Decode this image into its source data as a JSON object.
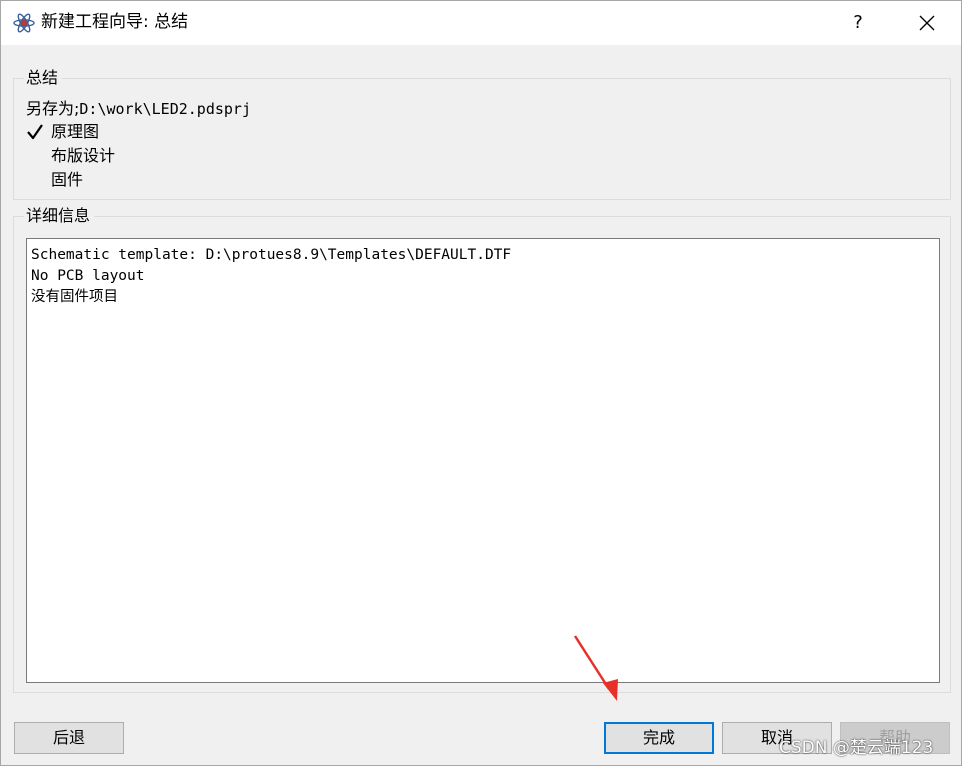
{
  "window": {
    "title": "新建工程向导: 总结",
    "help_label": "?",
    "icons": {
      "app": "proteus-app-icon",
      "close": "close-icon",
      "check": "checkmark-icon"
    }
  },
  "summary": {
    "label": "总结",
    "save_as_prefix": "另存为;",
    "save_as_path": "D:\\work\\LED2.pdsprj",
    "items": [
      {
        "label": "原理图",
        "checked": true
      },
      {
        "label": "布版设计",
        "checked": false
      },
      {
        "label": "固件",
        "checked": false
      }
    ]
  },
  "details": {
    "label": "详细信息",
    "lines": [
      "Schematic template: D:\\protues8.9\\Templates\\DEFAULT.DTF",
      "No PCB layout",
      "没有固件项目"
    ]
  },
  "buttons": {
    "back": "后退",
    "finish": "完成",
    "cancel": "取消",
    "help": "帮助"
  },
  "colors": {
    "dialog_bg": "#f0f0f0",
    "titlebar_bg": "#ffffff",
    "focus_border": "#0078d7",
    "annotation_arrow": "#e8302a"
  },
  "watermark": "CSDN @楚云端123"
}
